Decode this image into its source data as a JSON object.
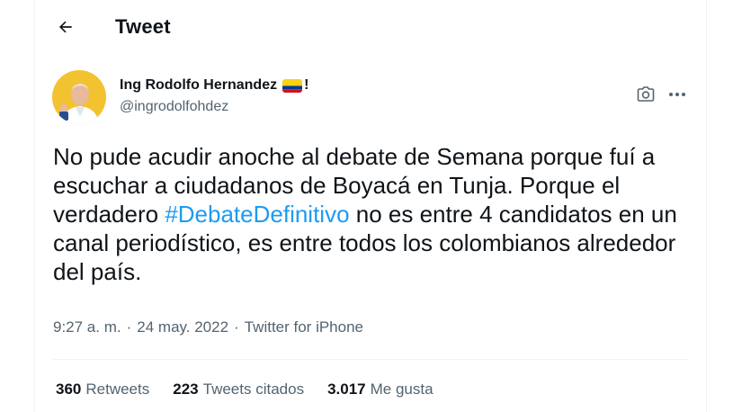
{
  "header": {
    "title": "Tweet",
    "back_icon": "arrow-left-icon"
  },
  "author": {
    "name": "Ing Rodolfo Hernandez",
    "name_suffix": "!",
    "handle": "@ingrodolfohdez",
    "flag_icon": "colombia-flag-icon",
    "flag_colors": [
      "#fcd116",
      "#003893",
      "#ce1126"
    ],
    "avatar_bg": "#f2c230"
  },
  "tweet": {
    "text_before": "No pude acudir anoche al debate de Semana porque fuí a escuchar a ciudadanos de Boyacá en Tunja. Porque el verdadero ",
    "hashtag": "#DebateDefinitivo",
    "text_after": " no es entre 4 candidatos en un canal periodístico, es entre todos los colombianos alrededor del país.",
    "time": "9:27 a. m.",
    "separator": "·",
    "date": "24 may. 2022",
    "source": "Twitter for iPhone"
  },
  "stats": {
    "retweets_count": "360",
    "retweets_label": "Retweets",
    "quotes_count": "223",
    "quotes_label": "Tweets citados",
    "likes_count": "3.017",
    "likes_label": "Me gusta"
  },
  "colors": {
    "accent": "#1d9bf0",
    "text": "#0f1419",
    "secondary": "#536471",
    "border": "#eff3f4"
  }
}
